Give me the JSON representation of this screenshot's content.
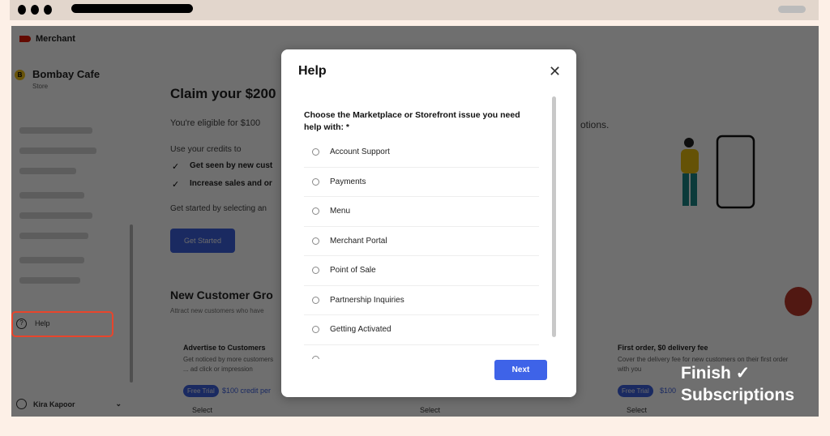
{
  "sidebar": {
    "brand": "Merchant",
    "store_initial": "B",
    "store_name": "Bombay Cafe",
    "store_type": "Store",
    "help_label": "Help",
    "user_name": "Kira Kapoor"
  },
  "main": {
    "title": "Claim your $200",
    "eligible": "You're eligible for $100",
    "eligible_tail": "otions.",
    "use_credits": "Use your credits to",
    "benefits": [
      "Get seen by new cust",
      "Increase sales and or"
    ],
    "get_started_text": "Get started by selecting an",
    "get_started_button": "Get Started",
    "section_title": "New Customer Gro",
    "section_sub": "Attract new customers who have",
    "cards": [
      {
        "title": "Advertise to Customers",
        "desc": "Get noticed by more customers ... ad click or impression",
        "tag": "Free Trial",
        "credit": "$100 credit per",
        "select": "Select"
      },
      {
        "select": "Select"
      },
      {
        "title": "First order, $0 delivery fee",
        "desc": "Cover the delivery fee for new customers on their first order with you",
        "tag": "Free Trial",
        "credit": "$100",
        "select": "Select"
      }
    ]
  },
  "modal": {
    "title": "Help",
    "question": "Choose the Marketplace or Storefront issue you need help with: *",
    "options": [
      "Account Support",
      "Payments",
      "Menu",
      "Merchant Portal",
      "Point of Sale",
      "Partnership Inquiries",
      "Getting Activated"
    ],
    "next_label": "Next"
  },
  "watermark": {
    "line1": "Finish ✓",
    "line2": "Subscriptions"
  },
  "colors": {
    "accent": "#3e63e8",
    "highlight": "#e8452c",
    "background": "#fdf0e7"
  }
}
